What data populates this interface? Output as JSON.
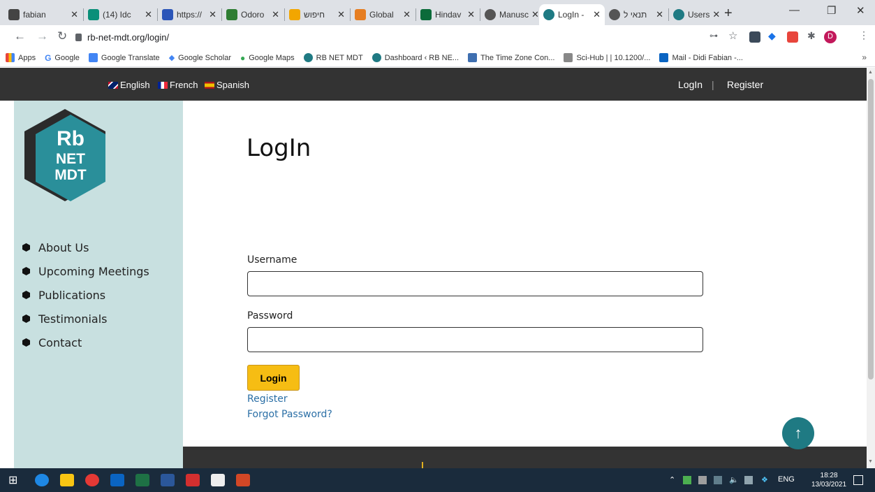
{
  "browser": {
    "tabs": [
      {
        "label": "fabian",
        "color": "#444"
      },
      {
        "label": "(14) Idc",
        "color": "#0a8f79"
      },
      {
        "label": "https://",
        "color": "#2b55b8"
      },
      {
        "label": "Odoro",
        "color": "#2e7d32"
      },
      {
        "label": "חיפוש",
        "color": "#f2a600"
      },
      {
        "label": "Global",
        "color": "#e67e22"
      },
      {
        "label": "Hindav",
        "color": "#0b6b3a"
      },
      {
        "label": "Manusc",
        "color": "#555"
      },
      {
        "label": "LogIn -",
        "color": "#1f7a83"
      },
      {
        "label": "תנאי ל",
        "color": "#555"
      },
      {
        "label": "Users",
        "color": "#1f7a83"
      }
    ],
    "url": "rb-net-mdt.org/login/",
    "bookmarks": [
      {
        "label": "Apps",
        "color": "#e8453c"
      },
      {
        "label": "Google",
        "color": "#4285f4"
      },
      {
        "label": "Google Translate",
        "color": "#4285f4"
      },
      {
        "label": "Google Scholar",
        "color": "#4285f4"
      },
      {
        "label": "Google Maps",
        "color": "#34a853"
      },
      {
        "label": "RB NET MDT",
        "color": "#1f7a83"
      },
      {
        "label": "Dashboard ‹ RB NE...",
        "color": "#1f7a83"
      },
      {
        "label": "The Time Zone Con...",
        "color": "#3f6fb0"
      },
      {
        "label": "Sci-Hub | | 10.1200/...",
        "color": "#888"
      },
      {
        "label": "Mail - Didi Fabian -...",
        "color": "#0a64c2"
      }
    ],
    "bookmarks_more": "»",
    "profile_initial": "D"
  },
  "site": {
    "languages": [
      {
        "label": "English"
      },
      {
        "label": "French"
      },
      {
        "label": "Spanish"
      }
    ],
    "auth": {
      "login": "LogIn",
      "separator": "|",
      "register": "Register"
    },
    "logo": {
      "line1": "Rb",
      "line2": "NET",
      "line3": "MDT"
    },
    "menu": [
      "About Us",
      "Upcoming Meetings",
      "Publications",
      "Testimonials",
      "Contact"
    ],
    "page_title": "LogIn",
    "form": {
      "username_label": "Username",
      "username_value": "",
      "password_label": "Password",
      "password_value": "",
      "submit_label": "Login",
      "register_link": "Register",
      "forgot_link": "Forgot Password?"
    },
    "scroll_top": "↑",
    "colors": {
      "topbar": "#333333",
      "sidebar": "#c8e0e0",
      "button": "#f6bd13",
      "link": "#2b6fa6",
      "accent": "#1f7a83"
    }
  },
  "taskbar": {
    "language": "ENG",
    "time": "18:28",
    "date": "13/03/2021"
  }
}
